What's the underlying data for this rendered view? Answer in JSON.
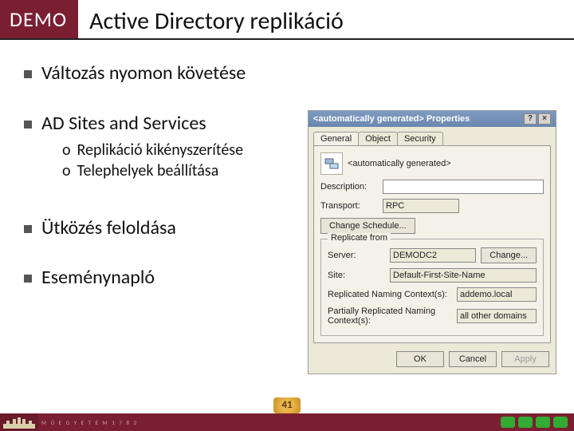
{
  "header": {
    "badge": "DEMO",
    "title": "Active Directory replikáció"
  },
  "bullets": {
    "b1": "Változás nyomon követése",
    "b2": "AD Sites and Services",
    "b2s1": "Replikáció kikényszerítése",
    "b2s2": "Telephelyek beállítása",
    "b3": "Ütközés feloldása",
    "b4": "Eseménynapló"
  },
  "dialog": {
    "title": "<automatically generated> Properties",
    "help_glyph": "?",
    "close_glyph": "×",
    "tabs": {
      "general": "General",
      "object": "Object",
      "security": "Security"
    },
    "heading": "<automatically generated>",
    "desc_label": "Description:",
    "transport_label": "Transport:",
    "transport_value": "RPC",
    "schedule_btn": "Change Schedule...",
    "group_title": "Replicate from",
    "server_label": "Server:",
    "server_value": "DEMODC2",
    "change_btn": "Change...",
    "site_label": "Site:",
    "site_value": "Default-First-Site-Name",
    "rnc_label": "Replicated Naming Context(s):",
    "rnc_value": "addemo.local",
    "prnc_label": "Partially Replicated Naming Context(s):",
    "prnc_value": "all other domains",
    "ok": "OK",
    "cancel": "Cancel",
    "apply": "Apply"
  },
  "page_number": "41",
  "footer_text": "M Ű E G Y E T E M   1 7 8 2"
}
